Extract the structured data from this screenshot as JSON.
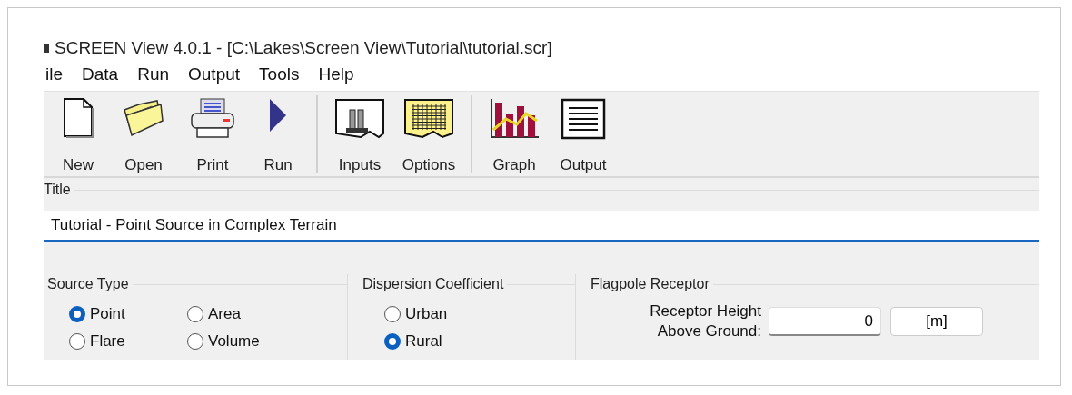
{
  "window": {
    "title": "SCREEN View 4.0.1 - [C:\\Lakes\\Screen View\\Tutorial\\tutorial.scr]"
  },
  "menu": [
    "ile",
    "Data",
    "Run",
    "Output",
    "Tools",
    "Help"
  ],
  "toolbar_groups": [
    [
      {
        "kind": "new",
        "label": "New"
      },
      {
        "kind": "open",
        "label": "Open"
      },
      {
        "kind": "print",
        "label": "Print"
      },
      {
        "kind": "run",
        "label": "Run"
      }
    ],
    [
      {
        "kind": "inputs",
        "label": "Inputs"
      },
      {
        "kind": "options",
        "label": "Options"
      }
    ],
    [
      {
        "kind": "graph",
        "label": "Graph"
      },
      {
        "kind": "output",
        "label": "Output"
      }
    ]
  ],
  "title_group": {
    "label": "Title",
    "value": "Tutorial - Point Source in Complex Terrain",
    "focused": true
  },
  "source_type": {
    "label": "Source Type",
    "options": [
      {
        "label": "Point",
        "selected": true
      },
      {
        "label": "Area",
        "selected": false
      },
      {
        "label": "Flare",
        "selected": false
      },
      {
        "label": "Volume",
        "selected": false
      }
    ]
  },
  "dispersion_coefficient": {
    "label": "Dispersion Coefficient",
    "options": [
      {
        "label": "Urban",
        "selected": false
      },
      {
        "label": "Rural",
        "selected": true
      }
    ]
  },
  "flagpole_receptor": {
    "label": "Flagpole Receptor",
    "field_label": "Receptor Height Above Ground:",
    "value": "0",
    "unit_button": "[m]"
  }
}
